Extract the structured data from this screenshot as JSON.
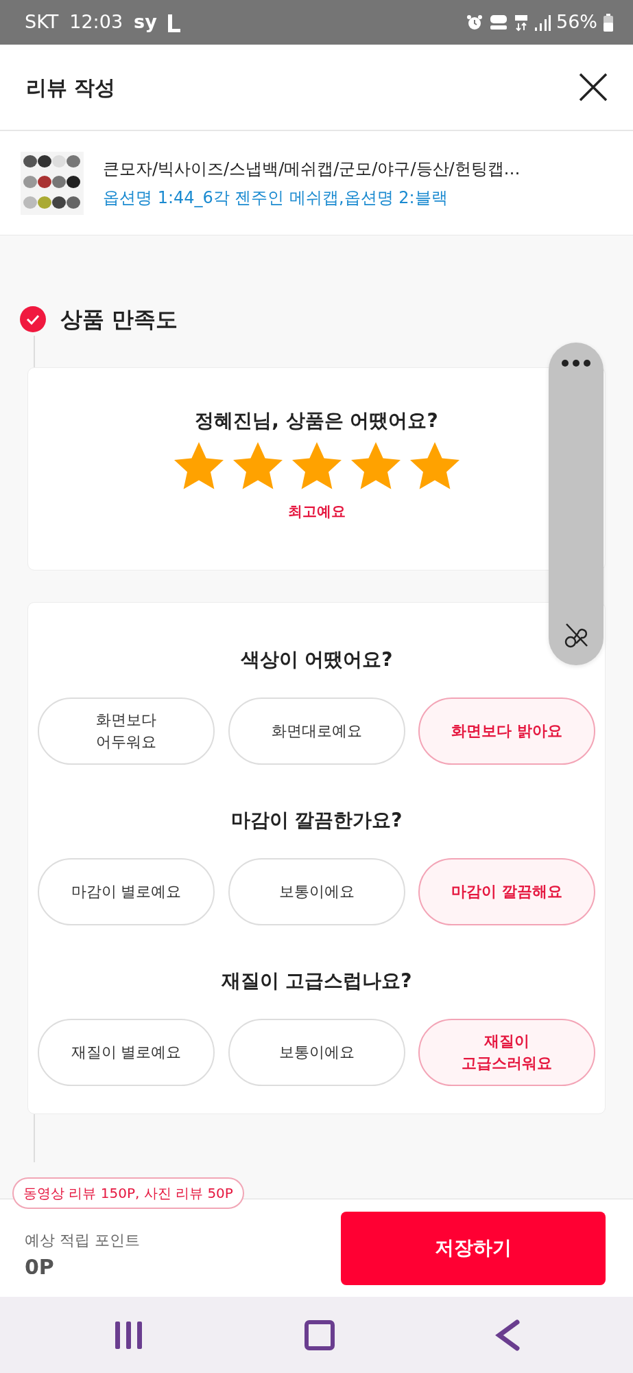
{
  "status_bar": {
    "carrier": "SKT",
    "time": "12:03",
    "extra": "sy",
    "battery": "56%"
  },
  "header": {
    "title": "리뷰 작성"
  },
  "product": {
    "name": "큰모자/빅사이즈/스냅백/메쉬캡/군모/야구/등산/헌팅캡…",
    "option": "옵션명 1:44_6각 젠주인 메쉬캡,옵션명 2:블랙"
  },
  "sections": [
    {
      "title": "상품 만족도",
      "checked": true
    }
  ],
  "rating": {
    "question": "정혜진님, 상품은 어땠어요?",
    "stars": 5,
    "caption": "최고예요"
  },
  "questions": [
    {
      "question": "색상이 어땠어요?",
      "options": [
        {
          "label": "화면보다\n어두워요",
          "selected": false
        },
        {
          "label": "화면대로예요",
          "selected": false
        },
        {
          "label": "화면보다 밝아요",
          "selected": true
        }
      ]
    },
    {
      "question": "마감이 깔끔한가요?",
      "options": [
        {
          "label": "마감이 별로예요",
          "selected": false
        },
        {
          "label": "보통이에요",
          "selected": false
        },
        {
          "label": "마감이 깔끔해요",
          "selected": true
        }
      ]
    },
    {
      "question": "재질이 고급스럽나요?",
      "options": [
        {
          "label": "재질이 별로예요",
          "selected": false
        },
        {
          "label": "보통이에요",
          "selected": false
        },
        {
          "label": "재질이\n고급스러워요",
          "selected": true
        }
      ]
    }
  ],
  "footer": {
    "badge": "동영상 리뷰 150P, 사진 리뷰 50P",
    "points_label": "예상 적립 포인트",
    "points": "0P",
    "save_button": "저장하기"
  }
}
